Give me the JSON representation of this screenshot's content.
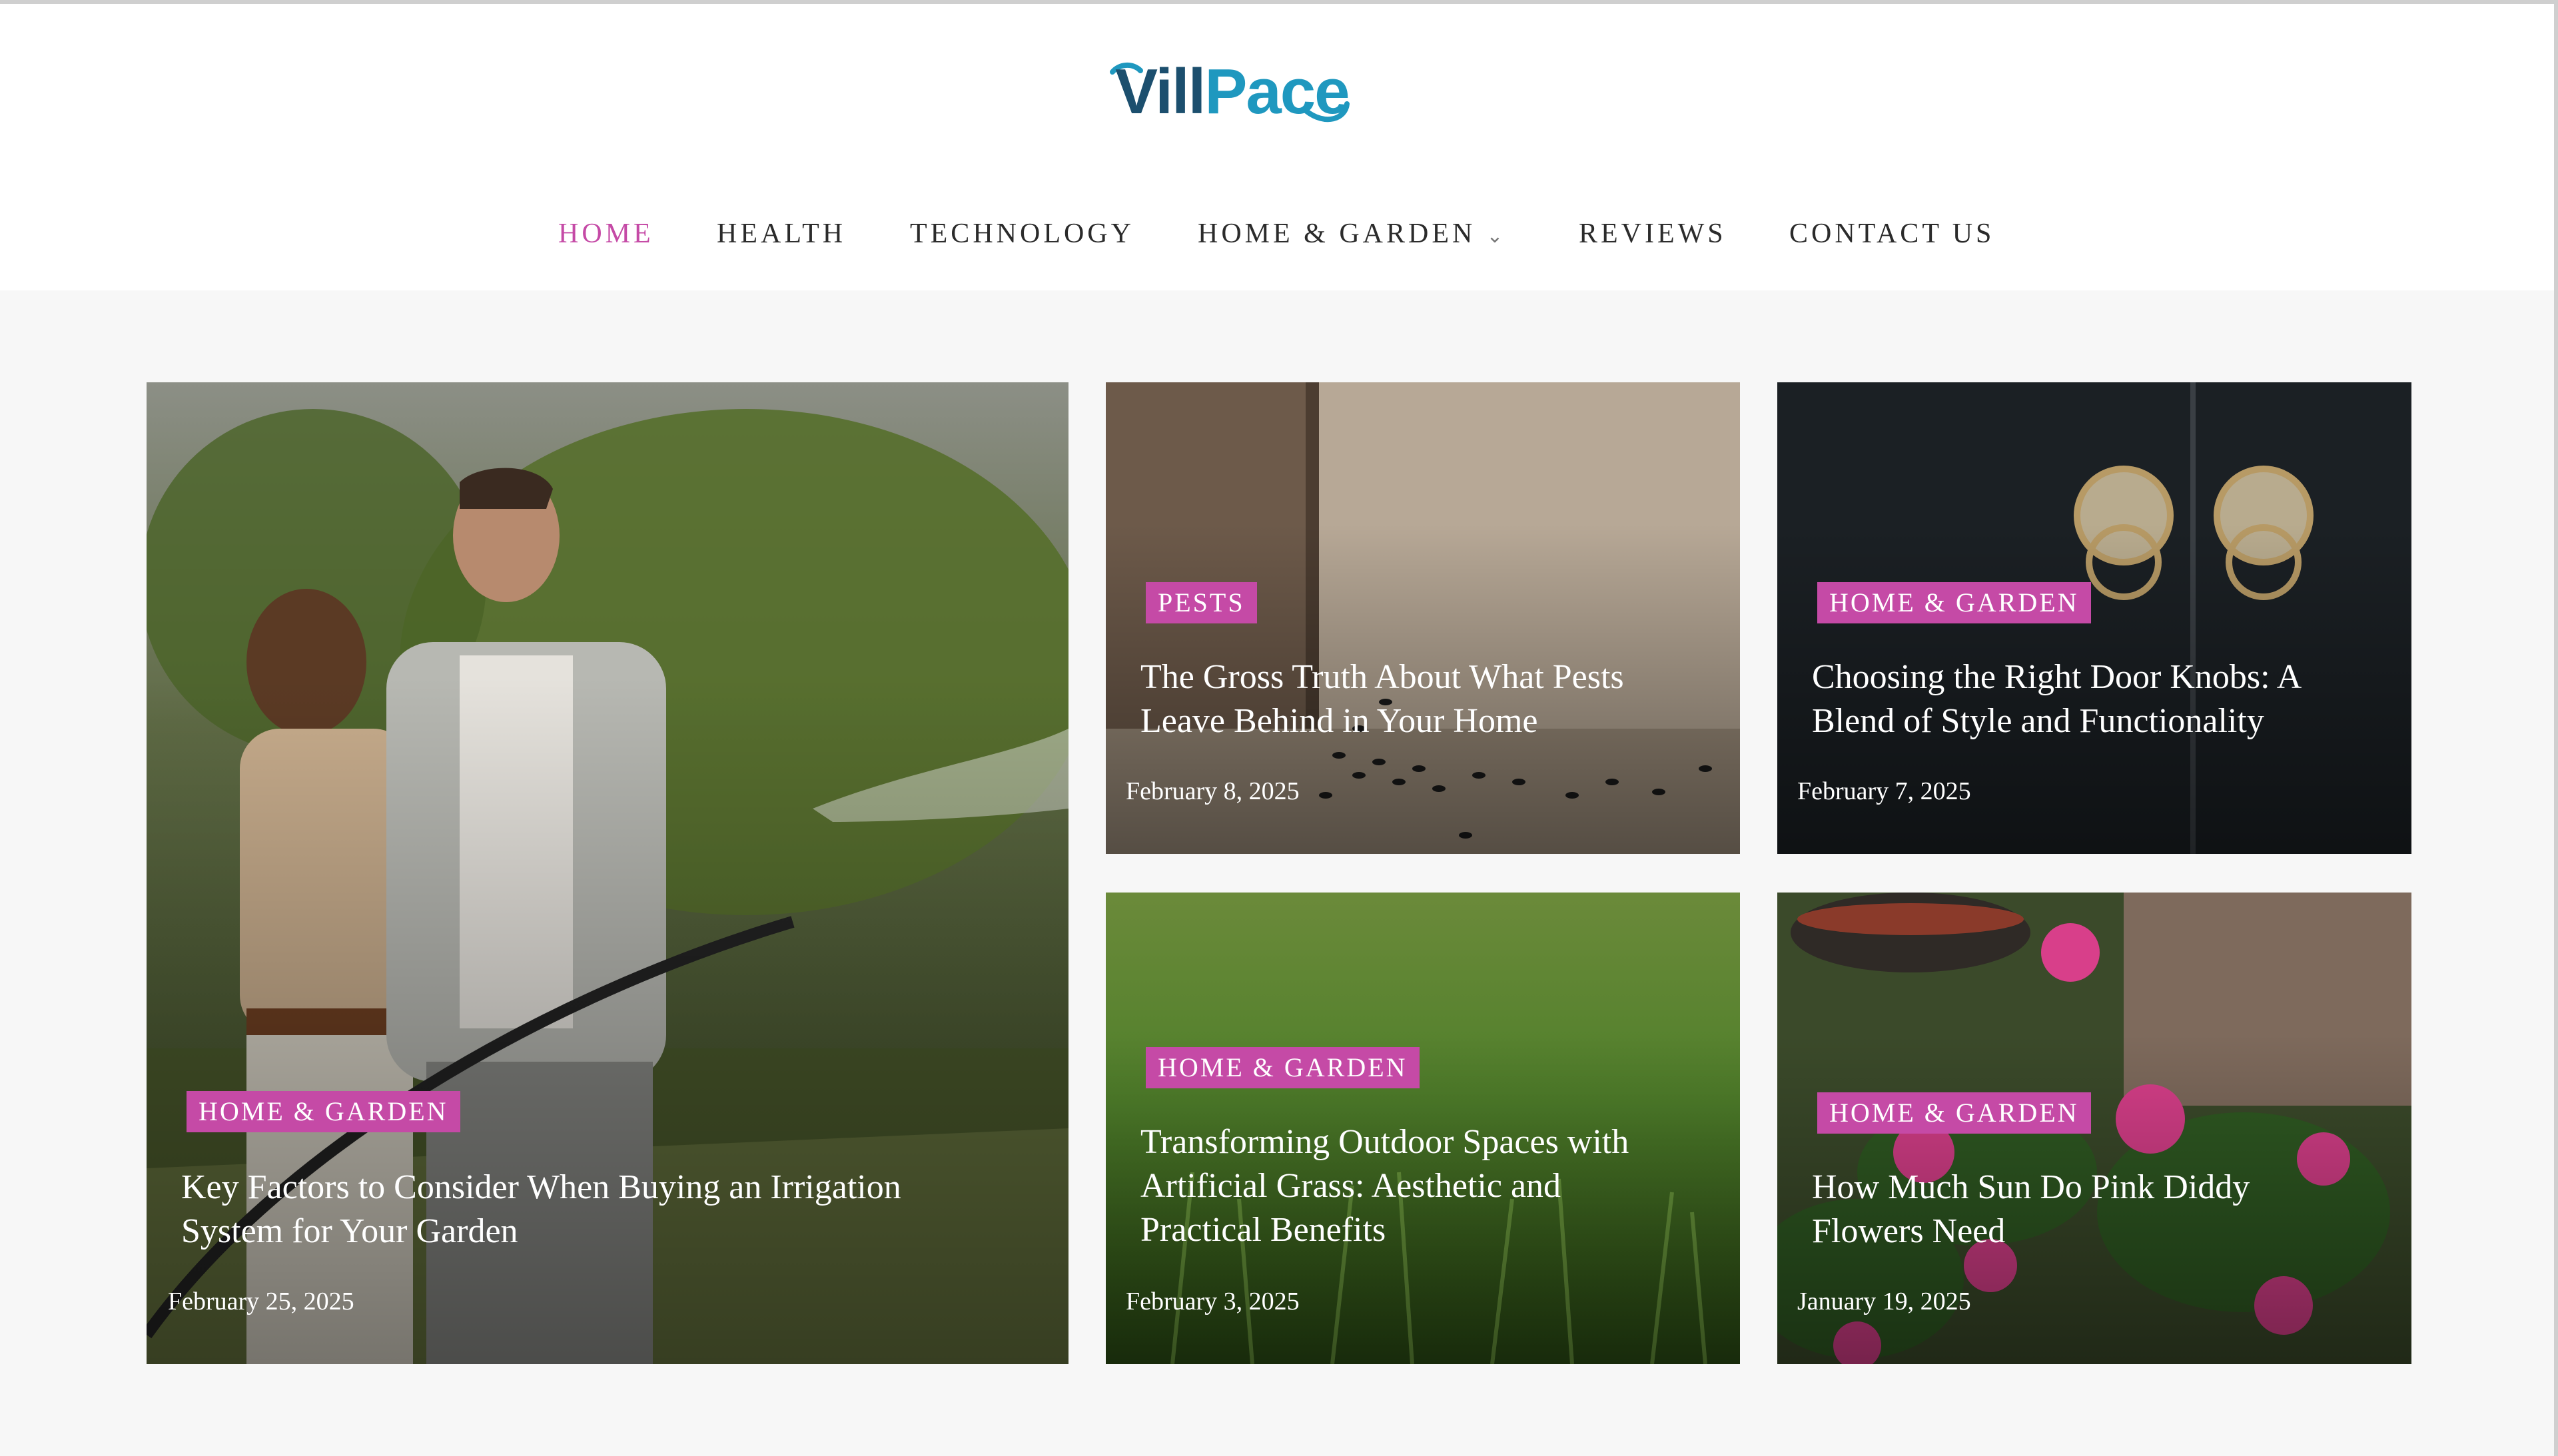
{
  "brand": {
    "logo_part1": "Vill",
    "logo_part2": "Pace",
    "colors": {
      "dark_teal": "#1c4f6e",
      "light_blue": "#1f98bf",
      "accent_pink": "#c54aa6"
    }
  },
  "nav": {
    "items": [
      {
        "label": "HOME",
        "active": true
      },
      {
        "label": "HEALTH"
      },
      {
        "label": "TECHNOLOGY"
      },
      {
        "label": "HOME & GARDEN",
        "has_dropdown": true,
        "icon": "chevron-down-icon"
      },
      {
        "label": "REVIEWS"
      },
      {
        "label": "CONTACT US"
      }
    ]
  },
  "posts": [
    {
      "category": "HOME & GARDEN",
      "title_line1": "Key Factors to Consider When Buying an Irrigation",
      "title_line2": "System for Your Garden",
      "date": "February 25, 2025"
    },
    {
      "category": "PESTS",
      "title_line1": "The Gross Truth About What Pests",
      "title_line2": "Leave Behind in Your Home",
      "date": "February 8, 2025"
    },
    {
      "category": "HOME & GARDEN",
      "title_line1": "Choosing the Right Door Knobs: A",
      "title_line2": "Blend of Style and Functionality",
      "date": "February 7, 2025"
    },
    {
      "category": "HOME & GARDEN",
      "title_line1": "Transforming Outdoor Spaces with",
      "title_line2": "Artificial Grass: Aesthetic and",
      "title_line3": "Practical Benefits",
      "date": "February 3, 2025"
    },
    {
      "category": "HOME & GARDEN",
      "title_line1": "How Much Sun Do Pink Diddy",
      "title_line2": "Flowers Need",
      "date": "January 19, 2025"
    }
  ]
}
